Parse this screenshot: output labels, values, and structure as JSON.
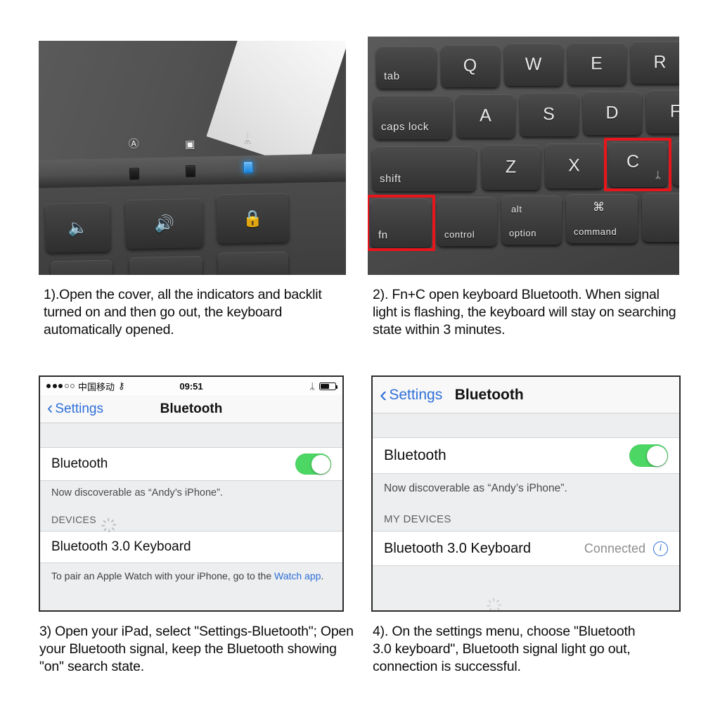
{
  "page": {
    "background_color": "#ffffff",
    "accent_red": "#e8151b",
    "ios_blue": "#2f6fd8",
    "ios_green": "#4cd663"
  },
  "panels": [
    {
      "id": "panel-1",
      "type": "photo-keyboard-indicators",
      "caption": "1).Open the cover, all the indicators and backlit\n turned on and then go out, the keyboard\nautomatically opened.",
      "indicators": [
        {
          "name": "caps-lock-indicator",
          "glyph": "Ⓐ",
          "led_on": false
        },
        {
          "name": "battery-indicator",
          "glyph": "▣",
          "led_on": false
        },
        {
          "name": "bluetooth-indicator",
          "glyph": "ᛦ",
          "led_on": true
        }
      ],
      "keys": [
        {
          "name": "volume-down-key",
          "glyph": "🔈"
        },
        {
          "name": "volume-up-key",
          "glyph": "🔊"
        },
        {
          "name": "lock-key",
          "glyph": "🔒"
        }
      ]
    },
    {
      "id": "panel-2",
      "type": "photo-keyboard-keys",
      "caption": "2).  Fn+C open keyboard Bluetooth. When signal\nlight is flashing, the keyboard will stay on searching\nstate within 3 minutes.",
      "rows": [
        {
          "keys": [
            {
              "label": "tab",
              "style": "word"
            },
            {
              "label": "Q",
              "style": "letter"
            },
            {
              "label": "W",
              "style": "letter"
            },
            {
              "label": "E",
              "style": "letter"
            },
            {
              "label": "R",
              "style": "letter"
            }
          ]
        },
        {
          "keys": [
            {
              "label": "caps lock",
              "style": "word"
            },
            {
              "label": "A",
              "style": "letter"
            },
            {
              "label": "S",
              "style": "letter"
            },
            {
              "label": "D",
              "style": "letter"
            },
            {
              "label": "F",
              "style": "letter"
            }
          ]
        },
        {
          "keys": [
            {
              "label": "shift",
              "style": "word"
            },
            {
              "label": "Z",
              "style": "letter"
            },
            {
              "label": "X",
              "style": "letter"
            },
            {
              "label": "C",
              "style": "letter",
              "sub_glyph": "ᛦ",
              "highlighted": true
            }
          ]
        },
        {
          "keys": [
            {
              "label": "fn",
              "style": "word",
              "highlighted": true
            },
            {
              "label": "control",
              "style": "small"
            },
            {
              "label": "option",
              "style": "small",
              "top_label": "alt"
            },
            {
              "label": "command",
              "style": "small",
              "top_label": "⌘"
            }
          ]
        }
      ],
      "highlight_note": "red boxes mark the fn key and the C key"
    },
    {
      "id": "panel-3",
      "type": "ios-bluetooth-searching",
      "caption": "3) Open your iPad, select \"Settings-Bluetooth\"; Open\nyour Bluetooth signal, keep the Bluetooth showing\n\"on\" search state.",
      "status_bar": {
        "signal_filled": 3,
        "signal_hollow": 2,
        "carrier": "中国移动",
        "wifi_icon": "wifi-icon",
        "time": "09:51",
        "bluetooth_icon": "ᛦ",
        "battery_level_pct": 55
      },
      "nav": {
        "back_label": "Settings",
        "title": "Bluetooth"
      },
      "bluetooth_row": {
        "label": "Bluetooth",
        "toggle_on": true
      },
      "discoverable_note": "Now discoverable as  “Andy’s iPhone”.",
      "devices_header": "DEVICES",
      "devices_spinner": true,
      "devices": [
        {
          "name": "Bluetooth 3.0 Keyboard",
          "status": ""
        }
      ],
      "footnote": "To pair an Apple Watch with your iPhone, go to the ",
      "footnote_link": "Watch app",
      "footnote_tail": "."
    },
    {
      "id": "panel-4",
      "type": "ios-bluetooth-connected",
      "caption": "4). On the settings menu, choose \"Bluetooth\n3.0 keyboard\", Bluetooth signal light go out,\nconnection is successful.",
      "nav": {
        "back_label": "Settings",
        "title": "Bluetooth"
      },
      "bluetooth_row": {
        "label": "Bluetooth",
        "toggle_on": true
      },
      "discoverable_note": "Now discoverable as  “Andy’s iPhone”.",
      "devices_header": "MY DEVICES",
      "devices": [
        {
          "name": "Bluetooth 3.0 Keyboard",
          "status": "Connected",
          "info_badge": "i"
        }
      ]
    }
  ]
}
